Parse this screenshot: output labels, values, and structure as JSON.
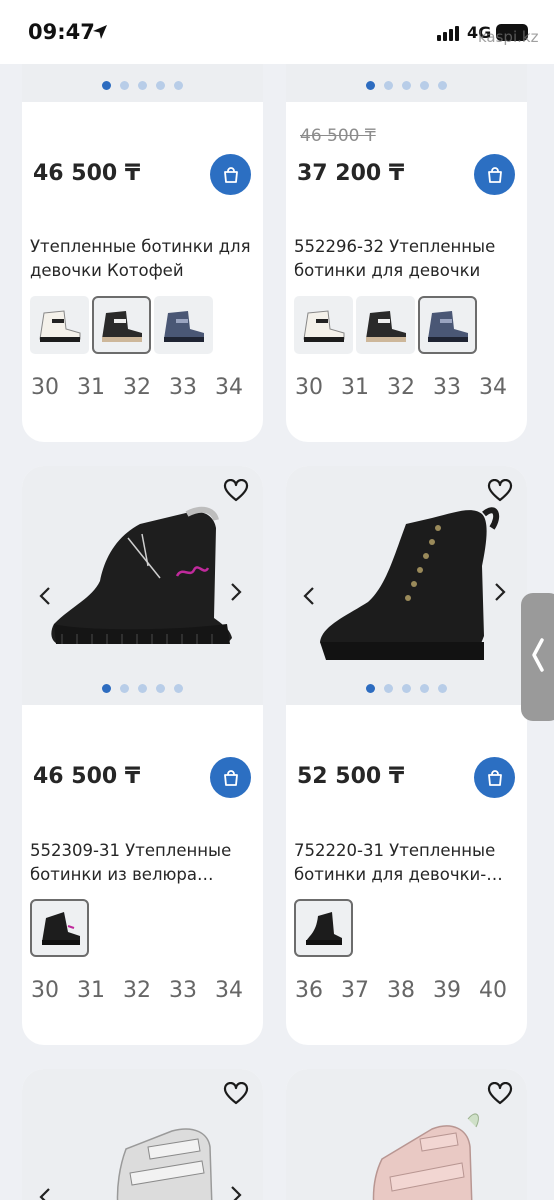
{
  "status_bar": {
    "time": "09:47",
    "network": "4G",
    "watermark": "kaspi.kz"
  },
  "products": [
    {
      "price": "46 500 ₸",
      "old_price": "",
      "title": "Утепленные ботинки для девочки Котофей",
      "sizes": [
        "30",
        "31",
        "32",
        "33",
        "34"
      ],
      "thumb_count": 3,
      "selected_thumb": 2,
      "dot_active": 1
    },
    {
      "price": "37 200 ₸",
      "old_price": "46 500 ₸",
      "title": "552296-32 Утепленные ботинки для девочки",
      "sizes": [
        "30",
        "31",
        "32",
        "33",
        "34"
      ],
      "thumb_count": 3,
      "selected_thumb": 3,
      "dot_active": 1
    },
    {
      "price": "46 500 ₸",
      "old_price": "",
      "title": "552309-31 Утепленные ботинки из велюра…",
      "sizes": [
        "30",
        "31",
        "32",
        "33",
        "34"
      ],
      "thumb_count": 1,
      "selected_thumb": 1,
      "dot_active": 1
    },
    {
      "price": "52 500 ₸",
      "old_price": "",
      "title": "752220-31 Утепленные ботинки для девочки-…",
      "sizes": [
        "36",
        "37",
        "38",
        "39",
        "40"
      ],
      "thumb_count": 1,
      "selected_thumb": 1,
      "dot_active": 1
    }
  ],
  "icons": {
    "cart": "shopping-bag-icon",
    "favorite": "heart-icon",
    "prev": "chevron-left-icon",
    "next": "chevron-right-icon"
  },
  "colors": {
    "accent": "#2c6fc2",
    "dot_active": "#2d6cc0",
    "dot_inactive": "#b8cde8",
    "background": "#eef0f4"
  }
}
